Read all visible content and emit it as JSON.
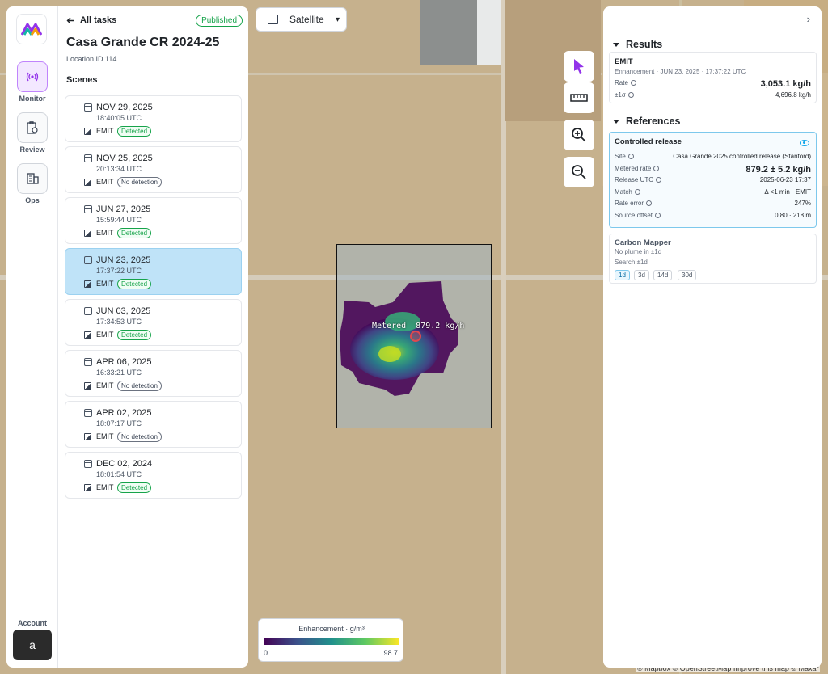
{
  "nav": {
    "items": [
      {
        "label": "Monitor",
        "icon": "broadcast-icon",
        "active": true
      },
      {
        "label": "Review",
        "icon": "clipboard-clock-icon",
        "active": false
      },
      {
        "label": "Ops",
        "icon": "building-icon",
        "active": false
      }
    ],
    "account_label": "Account",
    "account_initial": "a"
  },
  "task": {
    "back_label": "All tasks",
    "status": "Published",
    "title": "Casa Grande CR 2024-25",
    "location": "Location ID 114",
    "scenes_heading": "Scenes",
    "scenes": [
      {
        "date": "NOV 29, 2025",
        "time": "18:40:05 UTC",
        "sensor": "EMIT",
        "status": "Detected",
        "detected": true,
        "selected": false
      },
      {
        "date": "NOV 25, 2025",
        "time": "20:13:34 UTC",
        "sensor": "EMIT",
        "status": "No detection",
        "detected": false,
        "selected": false
      },
      {
        "date": "JUN 27, 2025",
        "time": "15:59:44 UTC",
        "sensor": "EMIT",
        "status": "Detected",
        "detected": true,
        "selected": false
      },
      {
        "date": "JUN 23, 2025",
        "time": "17:37:22 UTC",
        "sensor": "EMIT",
        "status": "Detected",
        "detected": true,
        "selected": true
      },
      {
        "date": "JUN 03, 2025",
        "time": "17:34:53 UTC",
        "sensor": "EMIT",
        "status": "Detected",
        "detected": true,
        "selected": false
      },
      {
        "date": "APR 06, 2025",
        "time": "16:33:21 UTC",
        "sensor": "EMIT",
        "status": "No detection",
        "detected": false,
        "selected": false
      },
      {
        "date": "APR 02, 2025",
        "time": "18:07:17 UTC",
        "sensor": "EMIT",
        "status": "No detection",
        "detected": false,
        "selected": false
      },
      {
        "date": "DEC 02, 2024",
        "time": "18:01:54 UTC",
        "sensor": "EMIT",
        "status": "Detected",
        "detected": true,
        "selected": false
      }
    ]
  },
  "map": {
    "basemap": "Satellite",
    "plume_label": "Metered  879.2 kg/h",
    "legend": {
      "title": "Enhancement · g/m³",
      "min": "0",
      "max": "98.7"
    },
    "attribution": "© Mapbox © OpenStreetMap  Improve this map © Maxar",
    "tools": [
      "select-cursor-icon",
      "ruler-icon",
      "zoom-in-icon",
      "zoom-out-icon"
    ]
  },
  "results": {
    "heading": "Results",
    "emit": {
      "title": "EMIT",
      "subtitle": "Enhancement · JUN 23, 2025 · 17:37:22 UTC",
      "rate_label": "Rate",
      "rate_value": "3,053.1 kg/h",
      "sigma_label": "±1σ",
      "sigma_value": "4,696.8 kg/h"
    }
  },
  "references": {
    "heading": "References",
    "controlled_release": {
      "title": "Controlled release",
      "rows": [
        {
          "label": "Site",
          "value": "Casa Grande 2025 controlled release (Stanford)"
        },
        {
          "label": "Metered rate",
          "value": "879.2 ± 5.2 kg/h"
        },
        {
          "label": "Release UTC",
          "value": "2025-06-23 17:37"
        },
        {
          "label": "Match",
          "value": "Δ <1 min · EMIT"
        },
        {
          "label": "Rate error",
          "value": "247%"
        },
        {
          "label": "Source offset",
          "value": "0.80 · 218 m"
        }
      ]
    },
    "carbon_mapper": {
      "title": "Carbon Mapper",
      "subtitle": "No plume in ±1d",
      "search_label": "Search ±1d",
      "windows": [
        {
          "label": "1d",
          "active": true
        },
        {
          "label": "3d",
          "active": false
        },
        {
          "label": "14d",
          "active": false
        },
        {
          "label": "30d",
          "active": false
        }
      ]
    }
  },
  "colors": {
    "accent_purple": "#9333ea",
    "selected_scene": "#bfe3f8",
    "detected_green": "#16a34a",
    "reference_border": "#7dc8ec"
  }
}
